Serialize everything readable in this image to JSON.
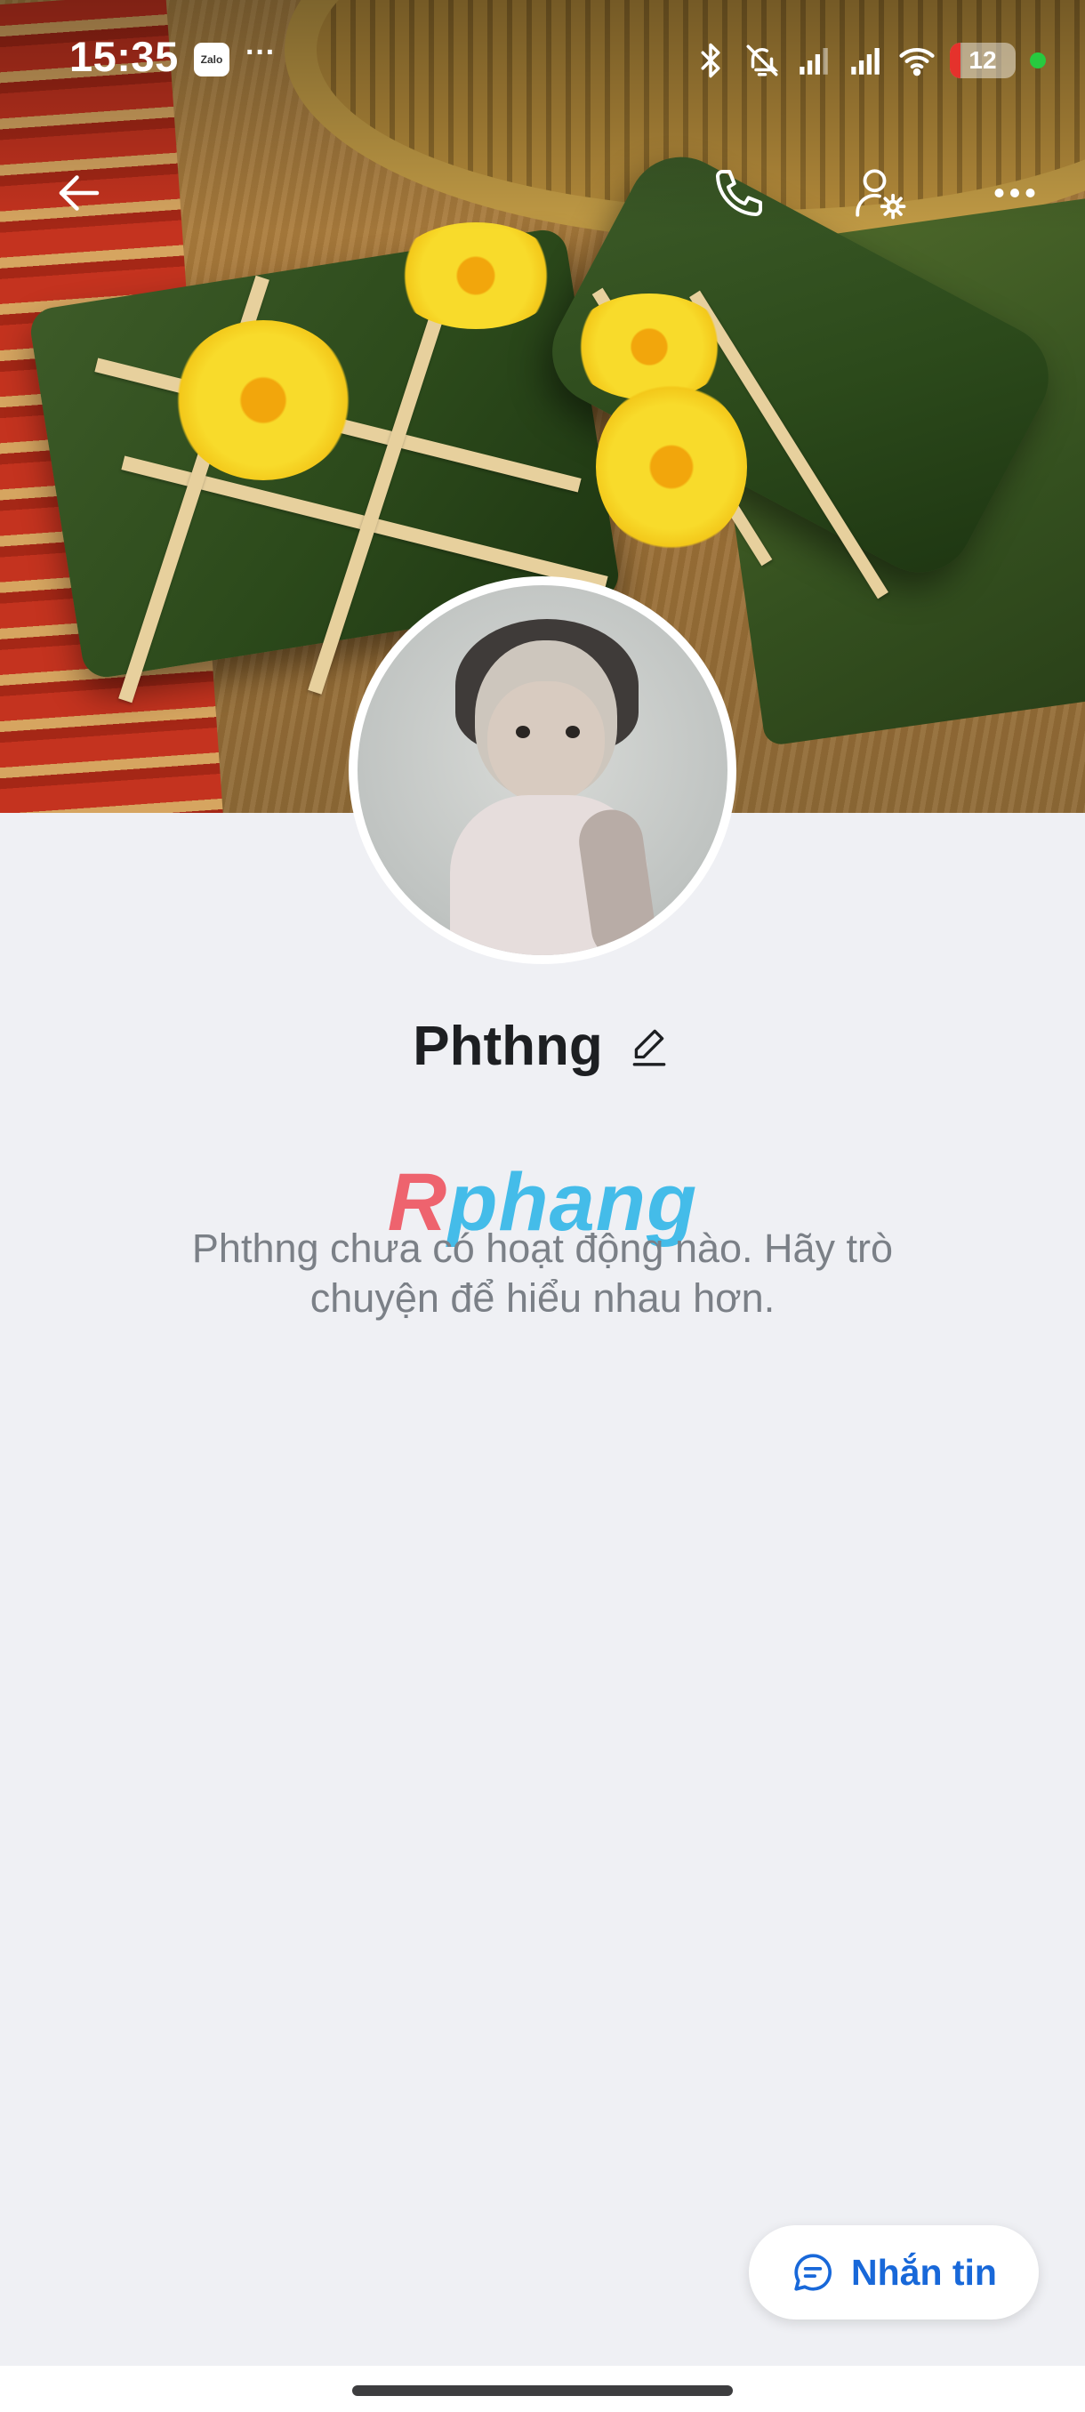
{
  "status_bar": {
    "time": "15:35",
    "zalo_label": "Zalo",
    "more_notifications": "···",
    "battery_level": "12",
    "icons": [
      "bluetooth-icon",
      "mute-icon",
      "signal-icon",
      "signal-icon",
      "wifi-icon",
      "battery-icon",
      "privacy-dot-icon"
    ]
  },
  "top_bar": {
    "icons": [
      "back-arrow-icon",
      "phone-icon",
      "user-settings-icon",
      "more-horizontal-icon"
    ]
  },
  "profile": {
    "name": "Phthng",
    "edit_icon": "pencil-icon"
  },
  "watermark": {
    "first_letter": "R",
    "rest": "phang"
  },
  "empty_state": {
    "message": "Phthng chưa có hoạt động nào. Hãy trò chuyện để hiểu nhau hơn."
  },
  "message_button": {
    "label": "Nhắn tin",
    "icon": "chat-bubble-icon"
  },
  "colors": {
    "accent": "#1868d9",
    "background": "#eff0f4",
    "name_text": "#1d1f22",
    "muted_text": "#7b8087"
  }
}
